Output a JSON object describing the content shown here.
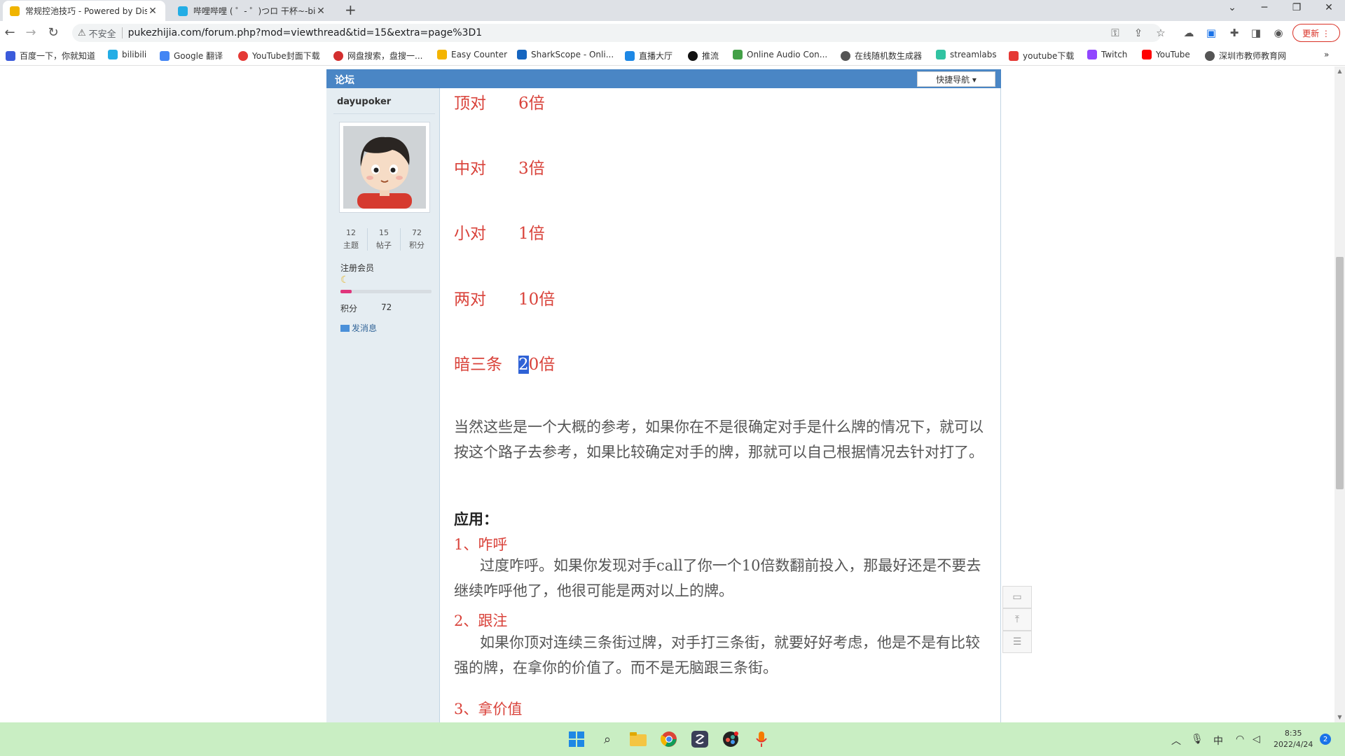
{
  "browser": {
    "tabs": [
      {
        "title": "常规控池技巧 - Powered by Dis",
        "close": "✕",
        "active": true
      },
      {
        "title": "哔哩哔哩 ( ゜- ゜)つロ 干杯~-bili",
        "close": "✕",
        "active": false
      }
    ],
    "new_tab": "+",
    "window_controls": {
      "minimize": "─",
      "restore": "❐",
      "close": "✕",
      "tabsearch": "⌄"
    },
    "nav": {
      "back": "←",
      "forward": "→",
      "reload": "↻"
    },
    "security_icon": "⚠",
    "security_label": "不安全",
    "url": "pukezhijia.com/forum.php?mod=viewthread&tid=15&extra=page%3D1",
    "update_label": "更新 ⋮",
    "bookmarks": [
      {
        "label": "百度一下，你就知道",
        "color": "#3b5bdb"
      },
      {
        "label": "bilibili",
        "color": "#23ade5"
      },
      {
        "label": "Google 翻译",
        "color": "#4285f4"
      },
      {
        "label": "YouTube封面下载",
        "color": "#e53935"
      },
      {
        "label": "网盘搜索，盘搜一...",
        "color": "#d32f2f"
      },
      {
        "label": "Easy Counter",
        "color": "#f4b400"
      },
      {
        "label": "SharkScope - Onli...",
        "color": "#1565c0"
      },
      {
        "label": "直播大厅",
        "color": "#1e88e5"
      },
      {
        "label": "推流",
        "color": "#111111"
      },
      {
        "label": "Online Audio Con...",
        "color": "#43a047"
      },
      {
        "label": "在线随机数生成器",
        "color": "#555555"
      },
      {
        "label": "streamlabs",
        "color": "#31c3a2"
      },
      {
        "label": "youtube下载",
        "color": "#e53935"
      },
      {
        "label": "Twitch",
        "color": "#9146ff"
      },
      {
        "label": "YouTube",
        "color": "#ff0000"
      },
      {
        "label": "深圳市教师教育网",
        "color": "#555555"
      }
    ],
    "bookmarks_more": "»"
  },
  "forum": {
    "header_title": "论坛",
    "quick_nav": "快捷导航 ▾"
  },
  "author": {
    "username": "dayupoker",
    "stats": [
      {
        "num": "12",
        "label": "主题"
      },
      {
        "num": "15",
        "label": "帖子"
      },
      {
        "num": "72",
        "label": "积分"
      }
    ],
    "group": "注册会员",
    "progress_fraction": 0.12,
    "points_label": "积分",
    "points_value": "72",
    "send_message": "发消息"
  },
  "post": {
    "multipliers": [
      {
        "label": "顶对",
        "value": "6倍"
      },
      {
        "label": "中对",
        "value": "3倍"
      },
      {
        "label": "小对",
        "value": "1倍"
      },
      {
        "label": "两对",
        "value": "10倍"
      },
      {
        "label": "暗三条",
        "value_sel": "2",
        "value_rest": "0倍"
      }
    ],
    "paragraph1": "当然这些是一个大概的参考，如果你在不是很确定对手是什么牌的情况下，就可以按这个路子去参考，如果比较确定对手的牌，那就可以自己根据情况去针对打了。",
    "apply_heading": "应用：",
    "items": [
      {
        "title": "1、咋呼",
        "body": "过度咋呼。如果你发现对手call了你一个10倍数翻前投入，那最好还是不要去继续咋呼他了，他很可能是两对以上的牌。"
      },
      {
        "title": "2、跟注",
        "body": "如果你顶对连续三条街过牌，对手打三条街，就要好好考虑，他是不是有比较强的牌，在拿你的价值了。而不是无脑跟三条街。"
      },
      {
        "title": "3、拿价值",
        "body": ""
      }
    ]
  },
  "taskbar": {
    "clock_time": "8:35",
    "clock_date": "2022/4/24",
    "ime": "中",
    "notifications": "2"
  }
}
